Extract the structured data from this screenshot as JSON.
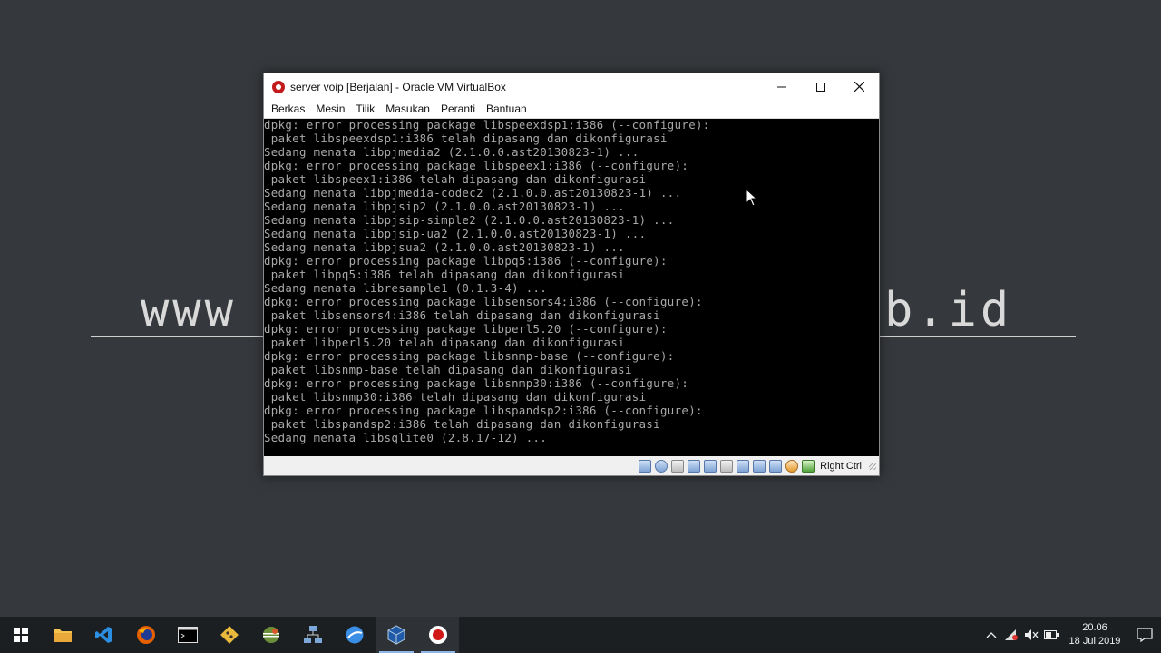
{
  "wallpaper": {
    "left_text": "www",
    "right_text": "b.id"
  },
  "window": {
    "title": "server voip [Berjalan] - Oracle VM VirtualBox",
    "minimize_glyph": "—",
    "maximize_glyph": "☐",
    "close_glyph": "✕"
  },
  "menu": [
    "Berkas",
    "Mesin",
    "Tilik",
    "Masukan",
    "Peranti",
    "Bantuan"
  ],
  "terminal": {
    "lines": [
      "dpkg: error processing package libspeexdsp1:i386 (--configure):",
      " paket libspeexdsp1:i386 telah dipasang dan dikonfigurasi",
      "Sedang menata libpjmedia2 (2.1.0.0.ast20130823-1) ...",
      "dpkg: error processing package libspeex1:i386 (--configure):",
      " paket libspeex1:i386 telah dipasang dan dikonfigurasi",
      "Sedang menata libpjmedia-codec2 (2.1.0.0.ast20130823-1) ...",
      "Sedang menata libpjsip2 (2.1.0.0.ast20130823-1) ...",
      "Sedang menata libpjsip-simple2 (2.1.0.0.ast20130823-1) ...",
      "Sedang menata libpjsip-ua2 (2.1.0.0.ast20130823-1) ...",
      "Sedang menata libpjsua2 (2.1.0.0.ast20130823-1) ...",
      "dpkg: error processing package libpq5:i386 (--configure):",
      " paket libpq5:i386 telah dipasang dan dikonfigurasi",
      "Sedang menata libresample1 (0.1.3-4) ...",
      "dpkg: error processing package libsensors4:i386 (--configure):",
      " paket libsensors4:i386 telah dipasang dan dikonfigurasi",
      "dpkg: error processing package libperl5.20 (--configure):",
      " paket libperl5.20 telah dipasang dan dikonfigurasi",
      "dpkg: error processing package libsnmp-base (--configure):",
      " paket libsnmp-base telah dipasang dan dikonfigurasi",
      "dpkg: error processing package libsnmp30:i386 (--configure):",
      " paket libsnmp30:i386 telah dipasang dan dikonfigurasi",
      "dpkg: error processing package libspandsp2:i386 (--configure):",
      " paket libspandsp2:i386 telah dipasang dan dikonfigurasi",
      "Sedang menata libsqlite0 (2.8.17-12) ..."
    ]
  },
  "statusbar": {
    "host_key": "Right Ctrl",
    "icons": [
      "hard-disk-icon",
      "optical-drive-icon",
      "audio-icon",
      "network-icon",
      "usb-icon",
      "shared-folders-icon",
      "display-icon",
      "video-capture-icon",
      "guest-additions-icon",
      "mouse-integration-icon",
      "cpu-icon",
      "keyboard-capture-icon"
    ]
  },
  "taskbar": {
    "apps": [
      {
        "name": "start-button",
        "icon": "windows-logo-icon"
      },
      {
        "name": "file-explorer",
        "icon": "folder-icon"
      },
      {
        "name": "vscode",
        "icon": "vscode-icon"
      },
      {
        "name": "firefox",
        "icon": "firefox-icon"
      },
      {
        "name": "terminal",
        "icon": "terminal-icon"
      },
      {
        "name": "git",
        "icon": "git-icon"
      },
      {
        "name": "eclipse",
        "icon": "eclipse-icon"
      },
      {
        "name": "network-tool",
        "icon": "network-tool-icon"
      },
      {
        "name": "browser",
        "icon": "globe-icon"
      },
      {
        "name": "virtualbox",
        "icon": "virtualbox-icon"
      },
      {
        "name": "screen-recorder",
        "icon": "record-icon"
      }
    ],
    "time": "20.06",
    "date": "18 Jul 2019"
  }
}
